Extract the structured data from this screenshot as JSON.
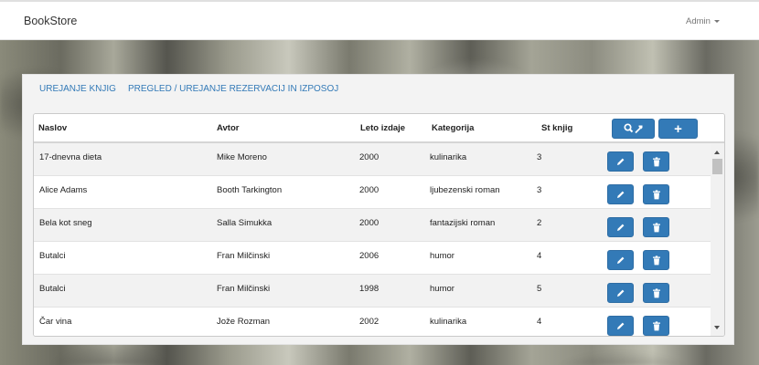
{
  "app": {
    "title": "BookStore",
    "user_label": "Admin"
  },
  "tabs": [
    {
      "label": "UREJANJE KNJIG"
    },
    {
      "label": "PREGLED / UREJANJE REZERVACIJ IN IZPOSOJ"
    }
  ],
  "table": {
    "columns": [
      "Naslov",
      "Avtor",
      "Leto izdaje",
      "Kategorija",
      "St knjig"
    ],
    "header_buttons": {
      "search_tools_icon": "search-wrench-icon",
      "add_label": "+"
    },
    "rows": [
      {
        "naslov": "17-dnevna dieta",
        "avtor": "Mike Moreno",
        "leto": "2000",
        "kategorija": "kulinarika",
        "st": "3"
      },
      {
        "naslov": "Alice Adams",
        "avtor": "Booth Tarkington",
        "leto": "2000",
        "kategorija": "ljubezenski roman",
        "st": "3"
      },
      {
        "naslov": "Bela kot sneg",
        "avtor": "Salla Simukka",
        "leto": "2000",
        "kategorija": "fantazijski roman",
        "st": "2"
      },
      {
        "naslov": "Butalci",
        "avtor": "Fran Milčinski",
        "leto": "2006",
        "kategorija": "humor",
        "st": "4"
      },
      {
        "naslov": "Butalci",
        "avtor": "Fran Milčinski",
        "leto": "1998",
        "kategorija": "humor",
        "st": "5"
      },
      {
        "naslov": "Čar vina",
        "avtor": "Jože Rozman",
        "leto": "2002",
        "kategorija": "kulinarika",
        "st": "4"
      }
    ],
    "row_actions": {
      "edit_icon": "pencil-icon",
      "delete_icon": "trash-icon"
    }
  },
  "colors": {
    "primary": "#337ab7",
    "link": "#337ab7"
  }
}
